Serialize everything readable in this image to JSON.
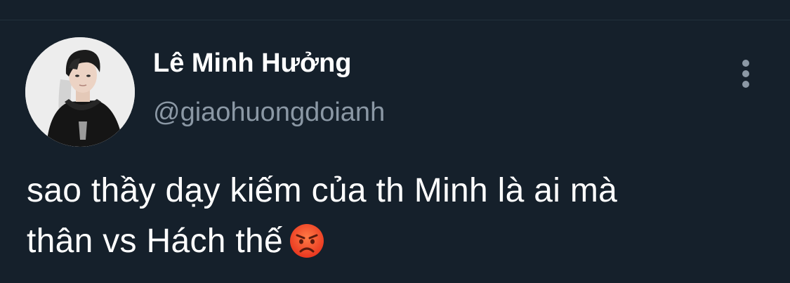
{
  "tweet": {
    "display_name": "Lê Minh Hưởng",
    "username": "@giaohuongdoianh",
    "text_line1": "sao thầy dạy kiếm của th Minh là ai mà",
    "text_line2": "thân vs Hách thế",
    "emoji": "angry-face-emoji",
    "more_icon": "more-vertical-icon",
    "avatar": "profile-photo"
  },
  "colors": {
    "background": "#15202b",
    "divider": "#22303c",
    "name": "#ffffff",
    "handle": "#8b98a5",
    "text": "#ffffff"
  }
}
